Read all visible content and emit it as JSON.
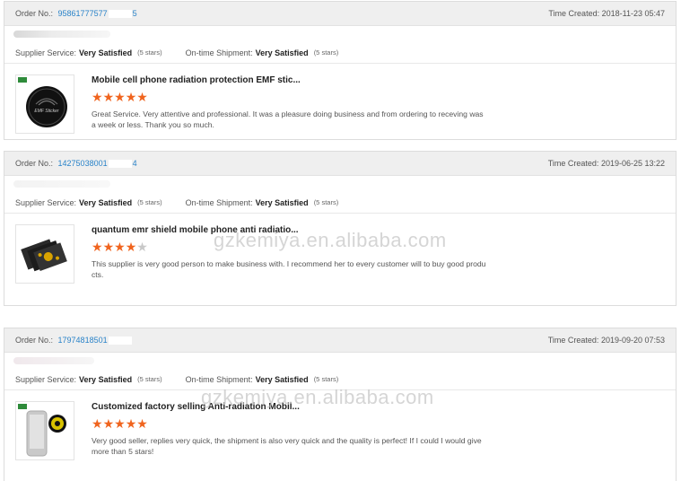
{
  "labels": {
    "order_no": "Order No.:",
    "time_created": "Time Created:",
    "supplier_service": "Supplier Service:",
    "ontime_shipment": "On-time Shipment:"
  },
  "orders": [
    {
      "order_no_start": "95861777577",
      "order_no_end": "5",
      "time_created": "2018-11-23 05:47",
      "supplier_rating": "Very Satisfied",
      "supplier_stars_note": "(5 stars)",
      "shipment_rating": "Very Satisfied",
      "shipment_stars_note": "(5 stars)",
      "product_title": "Mobile cell phone radiation protection EMF stic...",
      "stars": 5,
      "review": "Great Service.  Very attentive and professional.  It was a pleasure doing business and from ordering to receving was a week or less.  Thank you so much."
    },
    {
      "order_no_start": "14275038001",
      "order_no_end": "4",
      "time_created": "2019-06-25 13:22",
      "supplier_rating": "Very Satisfied",
      "supplier_stars_note": "(5 stars)",
      "shipment_rating": "Very Satisfied",
      "shipment_stars_note": "(5 stars)",
      "product_title": "quantum emr shield mobile phone anti radiatio...",
      "stars": 4,
      "review": "This supplier is very good person to make business with. I recommend her to every customer will to buy good products."
    },
    {
      "order_no_start": "17974818501",
      "order_no_end": "",
      "time_created": "2019-09-20 07:53",
      "supplier_rating": "Very Satisfied",
      "supplier_stars_note": "(5 stars)",
      "shipment_rating": "Very Satisfied",
      "shipment_stars_note": "(5 stars)",
      "product_title": "Customized factory selling Anti-radiation Mobil...",
      "stars": 5,
      "review": "Very good seller, replies very quick, the shipment is also very quick and the quality is perfect! If I could I would give more than 5 stars!"
    }
  ],
  "watermark": "gzkemiya.en.alibaba.com",
  "colors": {
    "star_on": "#f0641e",
    "star_off": "#c8c8c8",
    "link": "#2a83c9",
    "header_bg": "#efefef"
  }
}
